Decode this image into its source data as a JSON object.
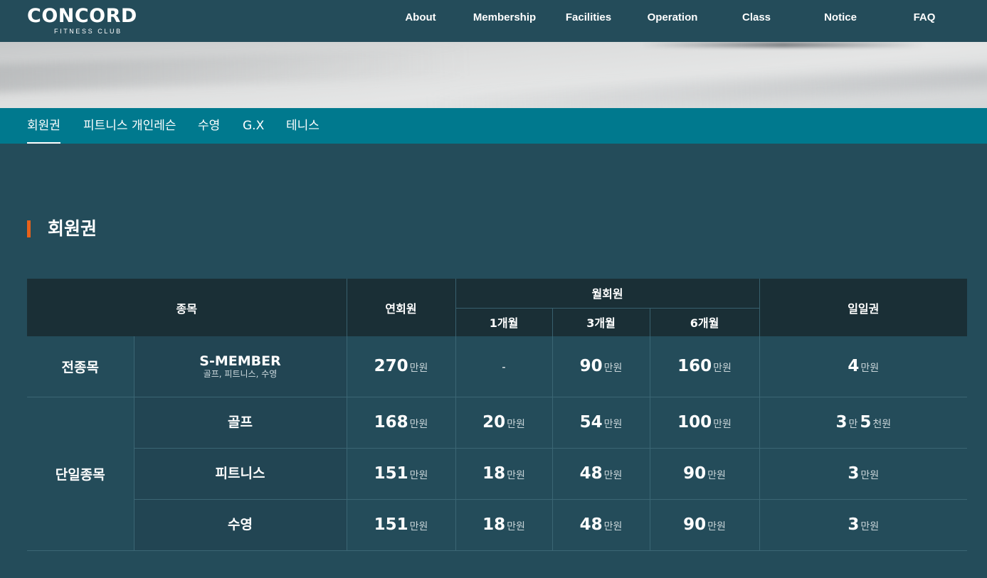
{
  "logo": {
    "main": "CONCORD",
    "sub": "FITNESS CLUB"
  },
  "nav": [
    "About",
    "Membership",
    "Facilities",
    "Operation",
    "Class",
    "Notice",
    "FAQ"
  ],
  "subtabs": [
    "회원권",
    "피트니스 개인레슨",
    "수영",
    "G.X",
    "테니스"
  ],
  "active_subtab": "회원권",
  "section_title": "회원권",
  "accent_color": "#e8611a",
  "table": {
    "headers": {
      "category": "종목",
      "annual": "연회원",
      "monthly": "월회원",
      "m1": "1개월",
      "m3": "3개월",
      "m6": "6개월",
      "daily": "일일권"
    },
    "units": {
      "manwon": "만원",
      "man": "만",
      "cheonwon": "천원"
    },
    "rows": [
      {
        "category": "전종목",
        "name": "S-MEMBER",
        "desc": "골프, 피트니스, 수영",
        "annual": "270",
        "m1": "-",
        "m3": "90",
        "m6": "160",
        "daily": "4"
      },
      {
        "category": "단일종목",
        "name": "골프",
        "annual": "168",
        "m1": "20",
        "m3": "54",
        "m6": "100",
        "daily_man": "3",
        "daily_cheon": "5"
      },
      {
        "name": "피트니스",
        "annual": "151",
        "m1": "18",
        "m3": "48",
        "m6": "90",
        "daily": "3"
      },
      {
        "name": "수영",
        "annual": "151",
        "m1": "18",
        "m3": "48",
        "m6": "90",
        "daily": "3"
      }
    ]
  }
}
